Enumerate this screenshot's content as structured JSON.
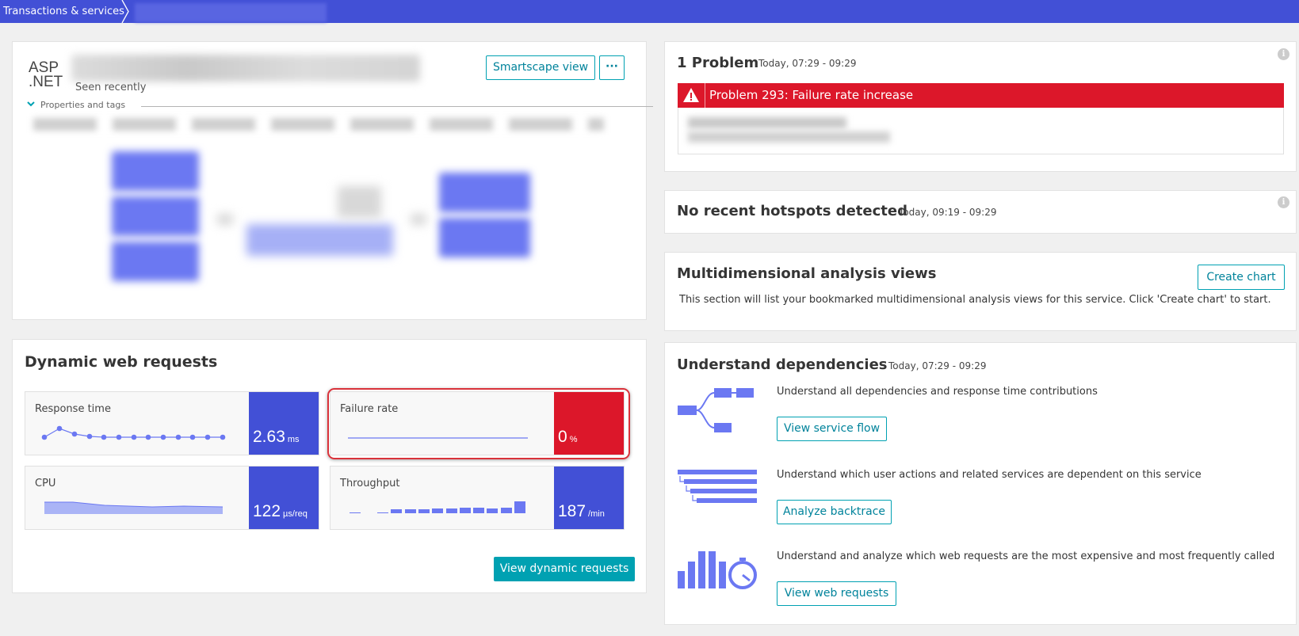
{
  "breadcrumb": {
    "first": "Transactions & services"
  },
  "service": {
    "logo_line1": "ASP",
    "logo_line2": ".NET",
    "seen": "Seen recently",
    "smartscape_btn": "Smartscape view",
    "more_btn": "···",
    "properties_label": "Properties and tags"
  },
  "dwr": {
    "title": "Dynamic web requests",
    "response_time": {
      "label": "Response time",
      "value": "2.63",
      "unit": "ms"
    },
    "failure_rate": {
      "label": "Failure rate",
      "value": "0",
      "unit": "%"
    },
    "cpu": {
      "label": "CPU",
      "value": "122",
      "unit": "µs/req"
    },
    "throughput": {
      "label": "Throughput",
      "value": "187",
      "unit": "/min"
    },
    "view_btn": "View dynamic requests"
  },
  "problem": {
    "title": "1 Problem",
    "time": "Today, 07:29 - 09:29",
    "banner": "Problem 293: Failure rate increase"
  },
  "hotspots": {
    "title": "No recent hotspots detected",
    "time": "Today, 09:19 - 09:29"
  },
  "mda": {
    "title": "Multidimensional analysis views",
    "desc": "This section will list your bookmarked multidimensional analysis views for this service. Click 'Create chart' to start.",
    "create_btn": "Create chart"
  },
  "deps": {
    "title": "Understand dependencies",
    "time": "Today, 07:29 - 09:29",
    "items": [
      {
        "text": "Understand all dependencies and response time contributions",
        "btn": "View service flow"
      },
      {
        "text": "Understand which user actions and related services are dependent on this service",
        "btn": "Analyze backtrace"
      },
      {
        "text": "Understand and analyze which web requests are the most expensive and most frequently called",
        "btn": "View web requests"
      }
    ]
  },
  "colors": {
    "brand": "#4250d6",
    "teal": "#00a1b2",
    "alert": "#dc172a"
  },
  "icons": [
    "info-icon",
    "warning-icon",
    "chevron-down-icon",
    "service-flow-icon",
    "backtrace-icon",
    "web-requests-icon"
  ]
}
